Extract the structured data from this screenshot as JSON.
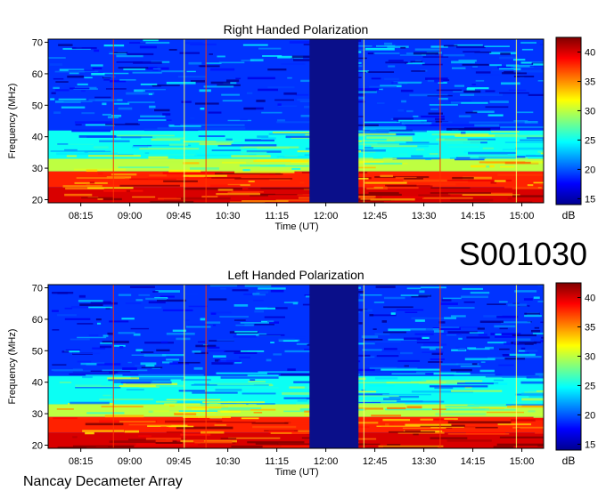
{
  "observation_id": "S001030",
  "footer": "Nancay Decameter Array",
  "colorbar": {
    "unit": "dB",
    "range": [
      14,
      42.5
    ],
    "ticks": [
      "15",
      "20",
      "25",
      "30",
      "35",
      "40"
    ],
    "colors": [
      "#00008f",
      "#0000ff",
      "#007fff",
      "#00ffff",
      "#7fff7f",
      "#ffff00",
      "#ff7f00",
      "#ff0000",
      "#7f0000"
    ]
  },
  "chart_data": [
    {
      "type": "heatmap",
      "title": "Right Handed Polarization",
      "xlabel": "Time (UT)",
      "ylabel": "Frequency (MHz)",
      "xticks": [
        "08:15",
        "09:00",
        "09:45",
        "10:30",
        "11:15",
        "12:00",
        "12:45",
        "13:30",
        "14:15",
        "15:00"
      ],
      "yticks": [
        "20",
        "30",
        "40",
        "50",
        "60",
        "70"
      ],
      "ylim": [
        19,
        71
      ],
      "xlim": [
        "07:45",
        "15:20"
      ],
      "color_unit": "dB",
      "color_range": [
        14,
        42.5
      ],
      "data_gap": [
        "11:45",
        "12:30"
      ],
      "bands": [
        {
          "freq_range": [
            19,
            24
          ],
          "level_db": 40
        },
        {
          "freq_range": [
            24,
            29
          ],
          "level_db": 38
        },
        {
          "freq_range": [
            29,
            33
          ],
          "level_db": 30
        },
        {
          "freq_range": [
            33,
            42
          ],
          "level_db": 25
        },
        {
          "freq_range": [
            42,
            71
          ],
          "level_db": 19
        }
      ],
      "vertical_lines_time": [
        "08:45",
        "09:50",
        "10:10",
        "12:35",
        "13:45",
        "14:55"
      ]
    },
    {
      "type": "heatmap",
      "title": "Left Handed Polarization",
      "xlabel": "Time (UT)",
      "ylabel": "Frequency (MHz)",
      "xticks": [
        "08:15",
        "09:00",
        "09:45",
        "10:30",
        "11:15",
        "12:00",
        "12:45",
        "13:30",
        "14:15",
        "15:00"
      ],
      "yticks": [
        "20",
        "30",
        "40",
        "50",
        "60",
        "70"
      ],
      "ylim": [
        19,
        71
      ],
      "xlim": [
        "07:45",
        "15:20"
      ],
      "color_unit": "dB",
      "color_range": [
        14,
        42.5
      ],
      "data_gap": [
        "11:45",
        "12:30"
      ],
      "bands": [
        {
          "freq_range": [
            19,
            24
          ],
          "level_db": 40
        },
        {
          "freq_range": [
            24,
            29
          ],
          "level_db": 38
        },
        {
          "freq_range": [
            29,
            33
          ],
          "level_db": 30
        },
        {
          "freq_range": [
            33,
            42
          ],
          "level_db": 25
        },
        {
          "freq_range": [
            42,
            71
          ],
          "level_db": 19
        }
      ],
      "vertical_lines_time": [
        "08:45",
        "09:50",
        "10:10",
        "12:35",
        "13:45",
        "14:55"
      ]
    }
  ]
}
